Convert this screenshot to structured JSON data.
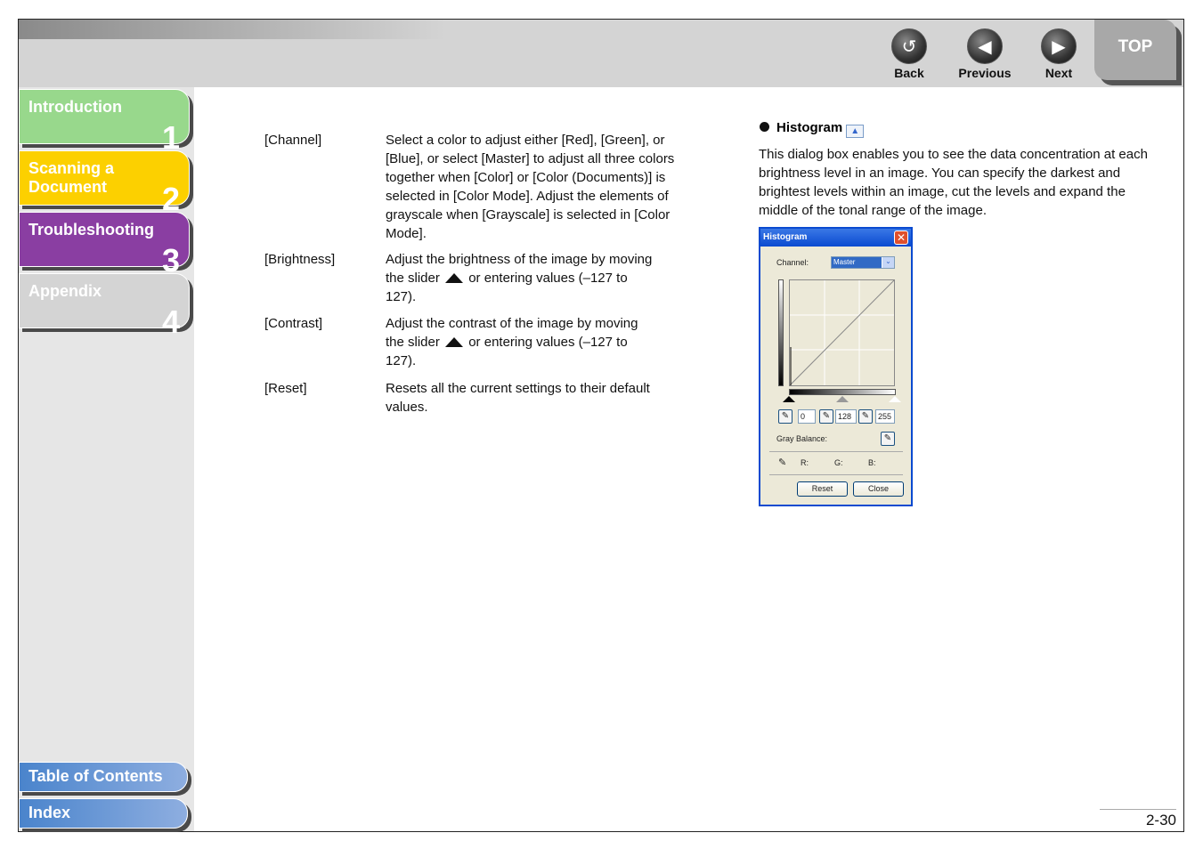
{
  "nav": {
    "back": "Back",
    "previous": "Previous",
    "next": "Next",
    "top": "TOP"
  },
  "sidebar": {
    "tabs": [
      {
        "label": "Introduction",
        "num": "1",
        "color": "#98d88c"
      },
      {
        "label": "Scanning a Document",
        "num": "2",
        "color": "#fcd000"
      },
      {
        "label": "Troubleshooting",
        "num": "3",
        "color": "#8a3ea2"
      },
      {
        "label": "Appendix",
        "num": "4",
        "color": "#d4d4d4"
      }
    ],
    "toc": "Table of Contents",
    "index": "Index"
  },
  "items": [
    {
      "term": "[Channel]",
      "desc": "Select a color to adjust either [Red], [Green], or [Blue], or select [Master] to adjust all three colors together when [Color] or [Color (Documents)] is selected in [Color Mode]. Adjust the elements of grayscale when [Grayscale] is selected in [Color Mode]."
    },
    {
      "term": "[Brightness]",
      "desc_a": "Adjust the brightness of the image by moving the slider",
      "desc_b": "or entering values (–127 to 127)."
    },
    {
      "term": "[Contrast]",
      "desc_a": "Adjust the contrast of the image by moving the slider",
      "desc_b": "or entering values (–127 to 127)."
    },
    {
      "term": "[Reset]",
      "desc": "Resets all the current settings to their default values."
    }
  ],
  "histogram": {
    "heading": "Histogram",
    "body": "This dialog box enables you to see the data concentration at each brightness level in an image. You can specify the darkest and brightest levels within an image, cut the levels and expand the middle of the tonal range of the image.",
    "dialog": {
      "title": "Histogram",
      "channel_label": "Channel:",
      "channel_value": "Master",
      "v0": "0",
      "v1": "128",
      "v2": "255",
      "gray_balance": "Gray Balance:",
      "r": "R:",
      "g": "G:",
      "b": "B:",
      "reset": "Reset",
      "close": "Close"
    }
  },
  "page_number": "2-30"
}
